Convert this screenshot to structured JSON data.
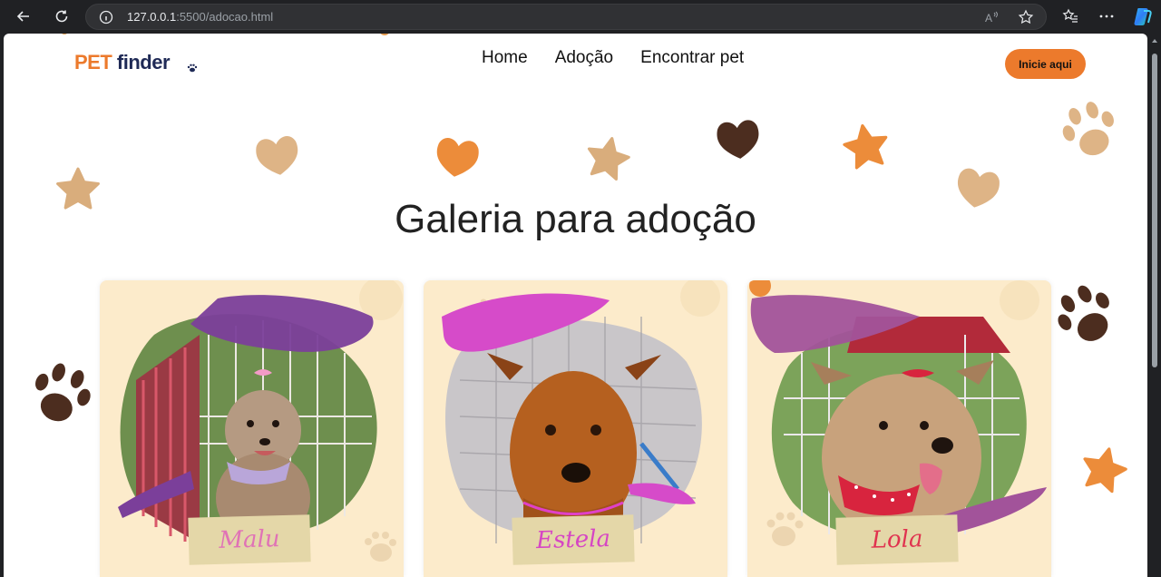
{
  "browser": {
    "url_host": "127.0.0.1",
    "url_path": ":5500/adocao.html"
  },
  "site": {
    "logo_pet": "PET",
    "logo_finder": "finder",
    "menu": [
      "Home",
      "Adoção",
      "Encontrar pet"
    ],
    "cta_label": "Inicie aqui",
    "heading": "Galeria para adoção",
    "colors": {
      "accent": "#ec7a2c",
      "navy": "#1f2a56",
      "card_bg": "#fcebcb"
    }
  },
  "pets": [
    {
      "name": "Malu",
      "name_color": "#e072b6",
      "brush_color": "#7b3f9a"
    },
    {
      "name": "Estela",
      "name_color": "#d645c4",
      "brush_color": "#d64bc9"
    },
    {
      "name": "Lola",
      "name_color": "#e0334f",
      "brush_color": "#a2539a"
    }
  ]
}
